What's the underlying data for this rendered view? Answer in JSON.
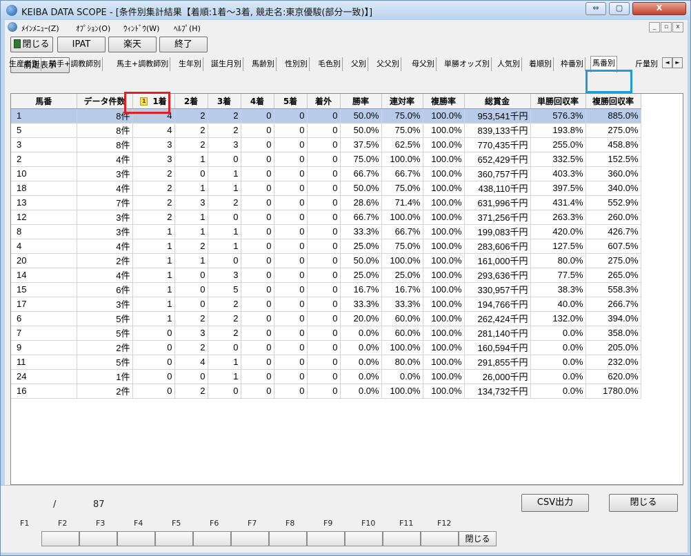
{
  "window": {
    "title": "KEIBA DATA SCOPE - [条件別集計結果【着順:1着～3着, 競走名:東京優駿(部分一致)】]",
    "min_label": "⇔",
    "max_label": "▢",
    "close_label": "X"
  },
  "menu": {
    "items": [
      "ﾒｲﾝﾒﾆｭｰ(Z)",
      "ｵﾌﾟｼｮﾝ(O)",
      "ｳｨﾝﾄﾞｳ(W)",
      "ﾍﾙﾌﾟ(H)"
    ],
    "mdi_buttons": [
      "_",
      "▫",
      "x"
    ]
  },
  "toolbar": {
    "close": "閉じる",
    "ipat": "IPAT",
    "rakuten": "楽天",
    "exit": "終了",
    "prev_race": "前走表示"
  },
  "tabs": [
    "生産者別",
    "騎手+調教師別",
    "馬主+調教師別",
    "生年別",
    "誕生月別",
    "馬齢別",
    "性別別",
    "毛色別",
    "父別",
    "父父別",
    "母父別",
    "単勝オッズ別",
    "人気別",
    "着順別",
    "枠番別",
    "馬番別",
    "斤量別"
  ],
  "active_tab": "馬番別",
  "tab_scroll": [
    "◄",
    "►"
  ],
  "table": {
    "sort_indicator": "1",
    "columns": [
      "馬番",
      "データ件数",
      "1着",
      "2着",
      "3着",
      "4着",
      "5着",
      "着外",
      "勝率",
      "連対率",
      "複勝率",
      "総賞金",
      "単勝回収率",
      "複勝回収率"
    ],
    "rows": [
      [
        "1",
        "8件",
        "4",
        "2",
        "2",
        "0",
        "0",
        "0",
        "50.0%",
        "75.0%",
        "100.0%",
        "953,541千円",
        "576.3%",
        "885.0%"
      ],
      [
        "5",
        "8件",
        "4",
        "2",
        "2",
        "0",
        "0",
        "0",
        "50.0%",
        "75.0%",
        "100.0%",
        "839,133千円",
        "193.8%",
        "275.0%"
      ],
      [
        "3",
        "8件",
        "3",
        "2",
        "3",
        "0",
        "0",
        "0",
        "37.5%",
        "62.5%",
        "100.0%",
        "770,435千円",
        "255.0%",
        "458.8%"
      ],
      [
        "2",
        "4件",
        "3",
        "1",
        "0",
        "0",
        "0",
        "0",
        "75.0%",
        "100.0%",
        "100.0%",
        "652,429千円",
        "332.5%",
        "152.5%"
      ],
      [
        "10",
        "3件",
        "2",
        "0",
        "1",
        "0",
        "0",
        "0",
        "66.7%",
        "66.7%",
        "100.0%",
        "360,757千円",
        "403.3%",
        "360.0%"
      ],
      [
        "18",
        "4件",
        "2",
        "1",
        "1",
        "0",
        "0",
        "0",
        "50.0%",
        "75.0%",
        "100.0%",
        "438,110千円",
        "397.5%",
        "340.0%"
      ],
      [
        "13",
        "7件",
        "2",
        "3",
        "2",
        "0",
        "0",
        "0",
        "28.6%",
        "71.4%",
        "100.0%",
        "631,996千円",
        "431.4%",
        "552.9%"
      ],
      [
        "12",
        "3件",
        "2",
        "1",
        "0",
        "0",
        "0",
        "0",
        "66.7%",
        "100.0%",
        "100.0%",
        "371,256千円",
        "263.3%",
        "260.0%"
      ],
      [
        "8",
        "3件",
        "1",
        "1",
        "1",
        "0",
        "0",
        "0",
        "33.3%",
        "66.7%",
        "100.0%",
        "199,083千円",
        "420.0%",
        "426.7%"
      ],
      [
        "4",
        "4件",
        "1",
        "2",
        "1",
        "0",
        "0",
        "0",
        "25.0%",
        "75.0%",
        "100.0%",
        "283,606千円",
        "127.5%",
        "607.5%"
      ],
      [
        "20",
        "2件",
        "1",
        "1",
        "0",
        "0",
        "0",
        "0",
        "50.0%",
        "100.0%",
        "100.0%",
        "161,000千円",
        "80.0%",
        "275.0%"
      ],
      [
        "14",
        "4件",
        "1",
        "0",
        "3",
        "0",
        "0",
        "0",
        "25.0%",
        "25.0%",
        "100.0%",
        "293,636千円",
        "77.5%",
        "265.0%"
      ],
      [
        "15",
        "6件",
        "1",
        "0",
        "5",
        "0",
        "0",
        "0",
        "16.7%",
        "16.7%",
        "100.0%",
        "330,957千円",
        "38.3%",
        "558.3%"
      ],
      [
        "17",
        "3件",
        "1",
        "0",
        "2",
        "0",
        "0",
        "0",
        "33.3%",
        "33.3%",
        "100.0%",
        "194,766千円",
        "40.0%",
        "266.7%"
      ],
      [
        "6",
        "5件",
        "1",
        "2",
        "2",
        "0",
        "0",
        "0",
        "20.0%",
        "60.0%",
        "100.0%",
        "262,424千円",
        "132.0%",
        "394.0%"
      ],
      [
        "7",
        "5件",
        "0",
        "3",
        "2",
        "0",
        "0",
        "0",
        "0.0%",
        "60.0%",
        "100.0%",
        "281,140千円",
        "0.0%",
        "358.0%"
      ],
      [
        "9",
        "2件",
        "0",
        "2",
        "0",
        "0",
        "0",
        "0",
        "0.0%",
        "100.0%",
        "100.0%",
        "160,594千円",
        "0.0%",
        "205.0%"
      ],
      [
        "11",
        "5件",
        "0",
        "4",
        "1",
        "0",
        "0",
        "0",
        "0.0%",
        "80.0%",
        "100.0%",
        "291,855千円",
        "0.0%",
        "232.0%"
      ],
      [
        "24",
        "1件",
        "0",
        "0",
        "1",
        "0",
        "0",
        "0",
        "0.0%",
        "0.0%",
        "100.0%",
        "26,000千円",
        "0.0%",
        "620.0%"
      ],
      [
        "16",
        "2件",
        "0",
        "2",
        "0",
        "0",
        "0",
        "0",
        "0.0%",
        "100.0%",
        "100.0%",
        "134,732千円",
        "0.0%",
        "1780.0%"
      ]
    ]
  },
  "status": {
    "separator": "/",
    "count": "87"
  },
  "buttons": {
    "csv": "CSV出力",
    "close": "閉じる"
  },
  "fkeys": [
    {
      "label": "F1",
      "text": ""
    },
    {
      "label": "F2",
      "text": ""
    },
    {
      "label": "F3",
      "text": ""
    },
    {
      "label": "F4",
      "text": ""
    },
    {
      "label": "F5",
      "text": ""
    },
    {
      "label": "F6",
      "text": ""
    },
    {
      "label": "F7",
      "text": ""
    },
    {
      "label": "F8",
      "text": ""
    },
    {
      "label": "F9",
      "text": ""
    },
    {
      "label": "F10",
      "text": ""
    },
    {
      "label": "F11",
      "text": ""
    },
    {
      "label": "F12",
      "text": "閉じる"
    }
  ]
}
